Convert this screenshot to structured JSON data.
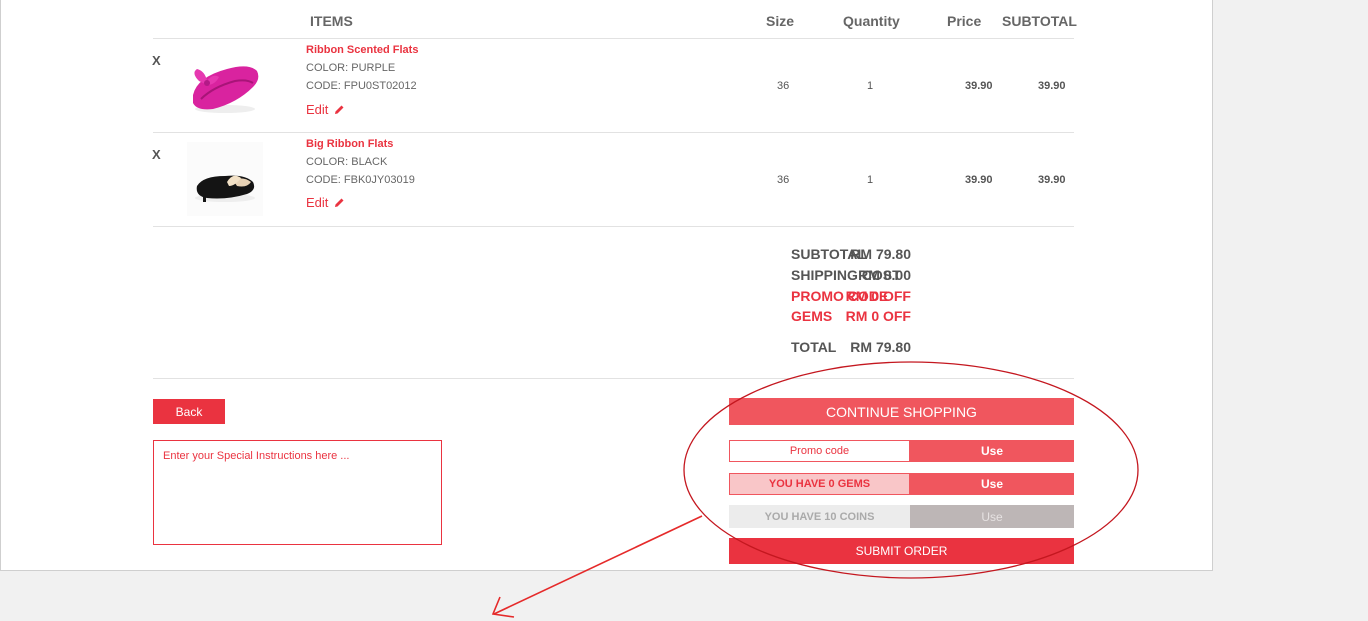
{
  "table": {
    "headers": {
      "items": "ITEMS",
      "size": "Size",
      "quantity": "Quantity",
      "price": "Price",
      "subtotal": "SUBTOTAL"
    },
    "rows": [
      {
        "remove": "X",
        "name": "Ribbon Scented Flats",
        "color": "COLOR: PURPLE",
        "code": "CODE: FPU0ST02012",
        "edit": "Edit",
        "size": "36",
        "quantity": "1",
        "price": "39.90",
        "subtotal": "39.90"
      },
      {
        "remove": "X",
        "name": "Big Ribbon Flats",
        "color": "COLOR: BLACK",
        "code": "CODE: FBK0JY03019",
        "edit": "Edit",
        "size": "36",
        "quantity": "1",
        "price": "39.90",
        "subtotal": "39.90"
      }
    ]
  },
  "summary": {
    "subtotal_label": "SUBTOTAL",
    "subtotal_value": "RM 79.80",
    "shipping_label": "SHIPPING COST",
    "shipping_value": "RM 0.00",
    "promo_label": "PROMO CODE",
    "promo_value": "RM 0 OFF",
    "gems_label": "GEMS",
    "gems_value": "RM 0 OFF",
    "total_label": "TOTAL",
    "total_value": "RM 79.80"
  },
  "actions": {
    "back": "Back",
    "instructions_placeholder": "Enter your Special Instructions here ...",
    "continue_shopping": "CONTINUE SHOPPING",
    "promo_placeholder": "Promo code",
    "use": "Use",
    "gems_text": "YOU HAVE 0 GEMS",
    "coins_text": "YOU HAVE 10 COINS",
    "submit": "SUBMIT ORDER"
  },
  "colors": {
    "accent": "#ea3340",
    "accent_soft": "#f0565e",
    "gems_bg": "#f9c6c8",
    "coins_bg": "#ececec",
    "coins_btn": "#bdb6b6"
  },
  "icons": [
    "pencil-icon"
  ]
}
